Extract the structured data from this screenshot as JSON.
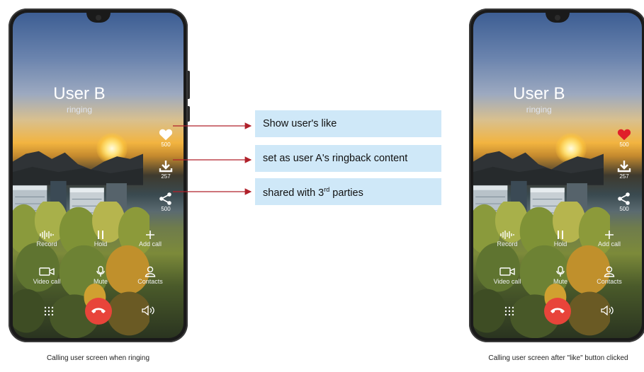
{
  "phone_left": {
    "caller_name": "User B",
    "call_status": "ringing",
    "like_count": "500",
    "download_count": "257",
    "share_count": "500",
    "like_color": "#ffffff",
    "controls": {
      "record": "Record",
      "hold": "Hold",
      "add_call": "Add call",
      "video_call": "Video call",
      "mute": "Mute",
      "contacts": "Contacts"
    },
    "caption": "Calling user screen when ringing"
  },
  "phone_right": {
    "caller_name": "User B",
    "call_status": "ringing",
    "like_count": "500",
    "download_count": "257",
    "share_count": "500",
    "like_color": "#e0202a",
    "controls": {
      "record": "Record",
      "hold": "Hold",
      "add_call": "Add call",
      "video_call": "Video call",
      "mute": "Mute",
      "contacts": "Contacts"
    },
    "caption": "Calling user screen after \"like\" button clicked"
  },
  "annotations": {
    "like": "Show user's like",
    "ringback": "set as user A's ringback content",
    "share_prefix": "shared with 3",
    "share_sup": "rd",
    "share_suffix": " parties",
    "arrow_color": "#b0202a",
    "box_color": "#cfe8f8"
  }
}
